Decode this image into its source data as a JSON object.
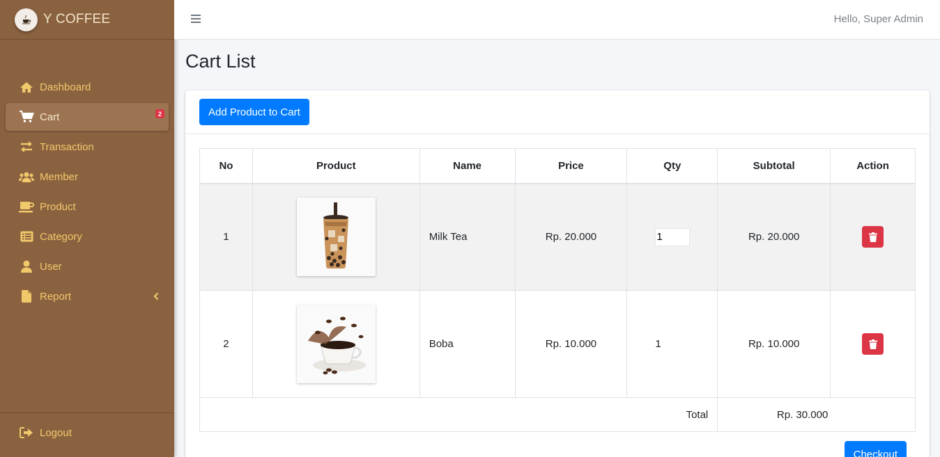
{
  "app": {
    "brand": "Y COFFEE"
  },
  "sidebar": {
    "items": [
      {
        "label": "Dashboard",
        "icon": "home-icon"
      },
      {
        "label": "Cart",
        "icon": "cart-icon",
        "badge": "2",
        "active": true
      },
      {
        "label": "Transaction",
        "icon": "exchange-icon"
      },
      {
        "label": "Member",
        "icon": "users-icon"
      },
      {
        "label": "Product",
        "icon": "mug-icon"
      },
      {
        "label": "Category",
        "icon": "list-icon"
      },
      {
        "label": "User",
        "icon": "user-icon"
      },
      {
        "label": "Report",
        "icon": "file-icon",
        "chevron": "chevron-left-icon"
      }
    ],
    "logout": "Logout"
  },
  "topbar": {
    "greeting": "Hello, Super Admin"
  },
  "page": {
    "title": "Cart List",
    "add_button": "Add Product to Cart"
  },
  "table": {
    "headers": [
      "No",
      "Product",
      "Name",
      "Price",
      "Qty",
      "Subtotal",
      "Action"
    ],
    "rows": [
      {
        "no": "1",
        "name": "Milk Tea",
        "price": "Rp. 20.000",
        "qty": "1",
        "subtotal": "Rp. 20.000"
      },
      {
        "no": "2",
        "name": "Boba",
        "price": "Rp. 10.000",
        "qty": "1",
        "subtotal": "Rp. 10.000"
      }
    ],
    "total_label": "Total",
    "total_value": "Rp. 30.000"
  },
  "checkout": "Checkout",
  "colors": {
    "sidebar": "#8b6240",
    "accent": "#f1c86a",
    "primary": "#007bff",
    "danger": "#dc3545"
  }
}
